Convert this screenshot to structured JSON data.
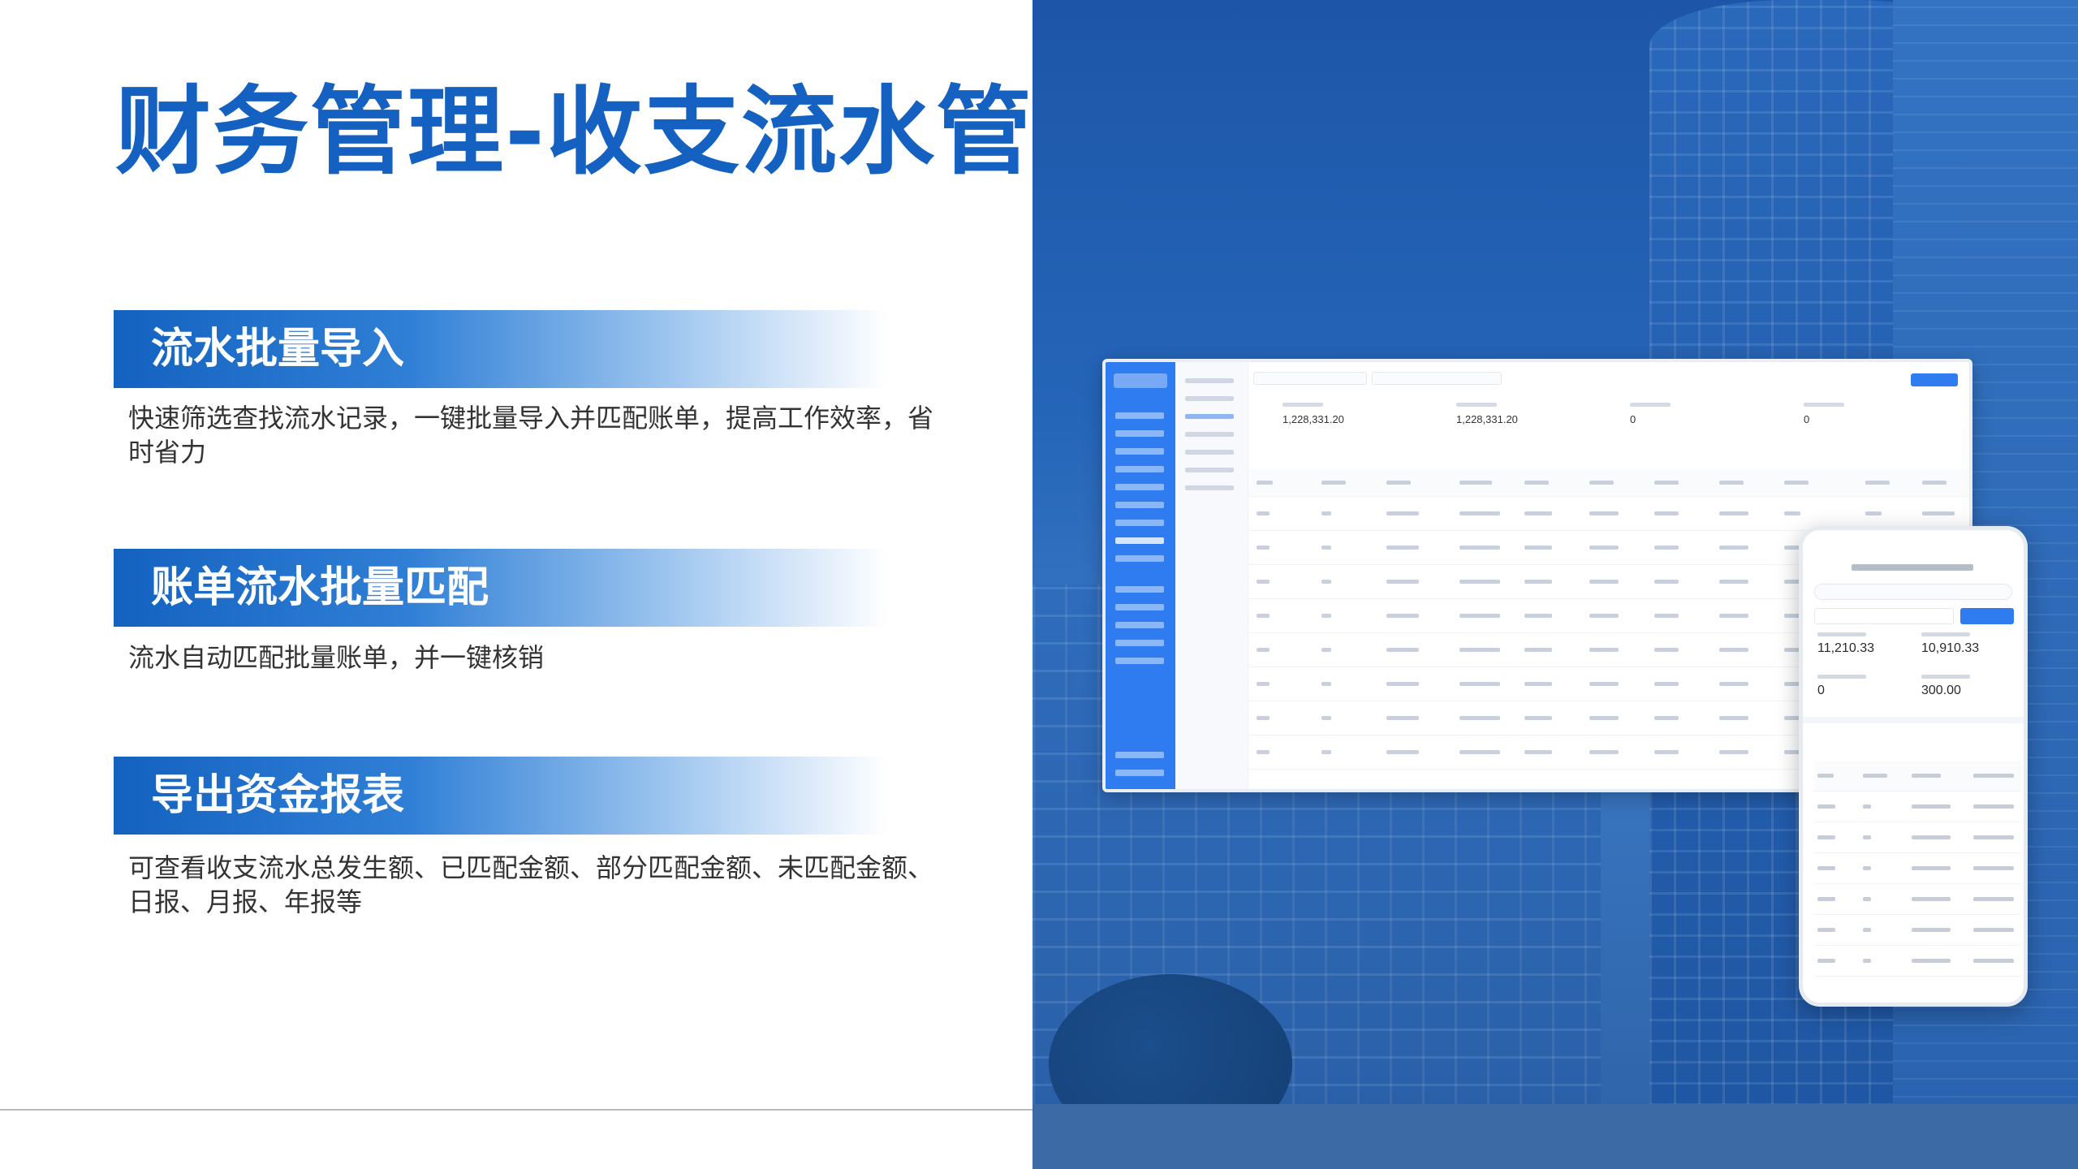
{
  "slide": {
    "title": "财务管理-收支流水管理",
    "features": [
      {
        "heading": "流水批量导入",
        "description": "快速筛选查找流水记录，一键批量导入并匹配账单，提高工作效率，省时省力"
      },
      {
        "heading": "账单流水批量匹配",
        "description": "流水自动匹配批量账单，并一键核销"
      },
      {
        "heading": "导出资金报表",
        "description": "可查看收支流水总发生额、已匹配金额、部分匹配金额、未匹配金额、日报、月报、年报等"
      }
    ]
  },
  "desktop_app": {
    "stats": [
      "1,228,331.20",
      "1,228,331.20",
      "0",
      "0"
    ]
  },
  "mobile_app": {
    "stats": [
      "11,210.33",
      "10,910.33",
      "0",
      "300.00"
    ]
  }
}
